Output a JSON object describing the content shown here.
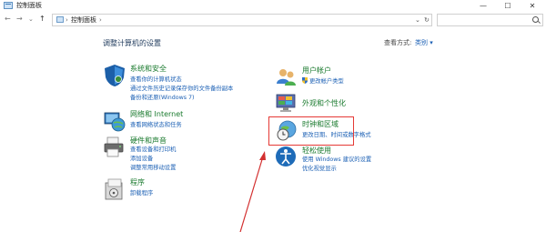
{
  "window": {
    "title": "控制面板",
    "controls": {
      "minimize": "—",
      "maximize": "☐",
      "close": "✕"
    }
  },
  "nav": {
    "back": "←",
    "forward": "→",
    "recent": "⌄",
    "up": "↑",
    "breadcrumb_sep": "›",
    "breadcrumb": "控制面板",
    "breadcrumb_after": "›",
    "dropdown": "⌄",
    "refresh": "↻"
  },
  "content": {
    "title": "调整计算机的设置",
    "view_by_label": "查看方式:",
    "view_by_value": "类别 ▾"
  },
  "categories": {
    "system": {
      "title": "系统和安全",
      "links": [
        "查看你的计算机状态",
        "通过文件历史记录保存你的文件备份副本",
        "备份和还原(Windows 7)"
      ]
    },
    "network": {
      "title": "网络和 Internet",
      "links": [
        "查看网络状态和任务"
      ]
    },
    "hardware": {
      "title": "硬件和声音",
      "links": [
        "查看设备和打印机",
        "添加设备",
        "调整常用移动设置"
      ]
    },
    "programs": {
      "title": "程序",
      "links": [
        "卸载程序"
      ]
    },
    "user": {
      "title": "用户帐户",
      "links": [
        "更改帐户类型"
      ]
    },
    "appearance": {
      "title": "外观和个性化",
      "links": []
    },
    "clock": {
      "title": "时钟和区域",
      "links": [
        "更改日期、时间或数字格式"
      ]
    },
    "ease": {
      "title": "轻松使用",
      "links": [
        "使用 Windows 建议的设置",
        "优化视觉显示"
      ]
    }
  },
  "colors": {
    "category_title": "#1a7a2e",
    "link": "#1a5fb4",
    "highlight": "#e53935"
  }
}
